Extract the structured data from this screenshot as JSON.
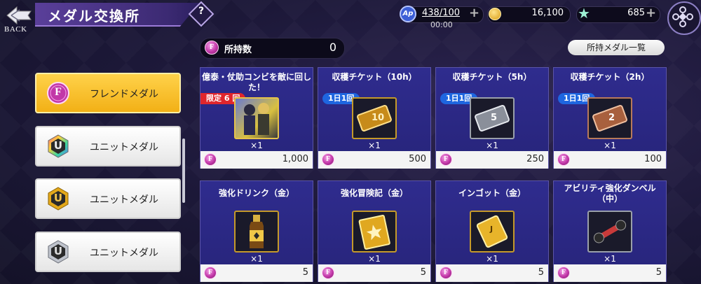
{
  "header": {
    "back_label": "BACK",
    "title": "メダル交換所",
    "help": "?",
    "ap_icon": "Ap",
    "ap_value": "438/100",
    "ap_timer": "00:00",
    "gold_value": "16,100",
    "star_value": "685",
    "plus": "+"
  },
  "holdings": {
    "coin": "F",
    "label": "所持数",
    "value": "0",
    "list_button": "所持メダル一覧"
  },
  "tabs": [
    {
      "label": "フレンドメダル",
      "badge": "F",
      "active": true
    },
    {
      "label": "ユニットメダル",
      "badge": "U",
      "active": false
    },
    {
      "label": "ユニットメダル",
      "badge": "U",
      "active": false
    },
    {
      "label": "ユニットメダル",
      "badge": "U",
      "active": false
    }
  ],
  "items": [
    {
      "name": "億泰・仗助コンビを敵に回した！",
      "badge": "限定 6 回",
      "qty": "×1",
      "price": "1,000",
      "icon": "character-art-icon"
    },
    {
      "name": "収穫チケット（10h）",
      "badge": "1日1回",
      "qty": "×1",
      "price": "500",
      "icon": "gold-ticket-icon",
      "ticket_num": "10"
    },
    {
      "name": "収穫チケット（5h）",
      "badge": "1日1回",
      "qty": "×1",
      "price": "250",
      "icon": "silver-ticket-icon",
      "ticket_num": "5"
    },
    {
      "name": "収穫チケット（2h）",
      "badge": "1日1回",
      "qty": "×1",
      "price": "100",
      "icon": "bronze-ticket-icon",
      "ticket_num": "2"
    },
    {
      "name": "強化ドリンク（金）",
      "badge": "",
      "qty": "×1",
      "price": "5",
      "icon": "drink-bottle-icon"
    },
    {
      "name": "強化冒険記（金）",
      "badge": "",
      "qty": "×1",
      "price": "5",
      "icon": "gold-book-icon"
    },
    {
      "name": "インゴット（金）",
      "badge": "",
      "qty": "×1",
      "price": "5",
      "icon": "gold-ingot-icon",
      "ingot_mark": "J"
    },
    {
      "name": "アビリティ強化ダンベル（中）",
      "badge": "",
      "qty": "×1",
      "price": "5",
      "icon": "dumbbell-icon"
    }
  ],
  "colors": {
    "accent_active_tab": "#f2b016",
    "card_bg": "#2a2782",
    "limit_badge": "#e0262c",
    "daily_badge": "#1e66e0",
    "medal_pink": "#c237a8"
  }
}
